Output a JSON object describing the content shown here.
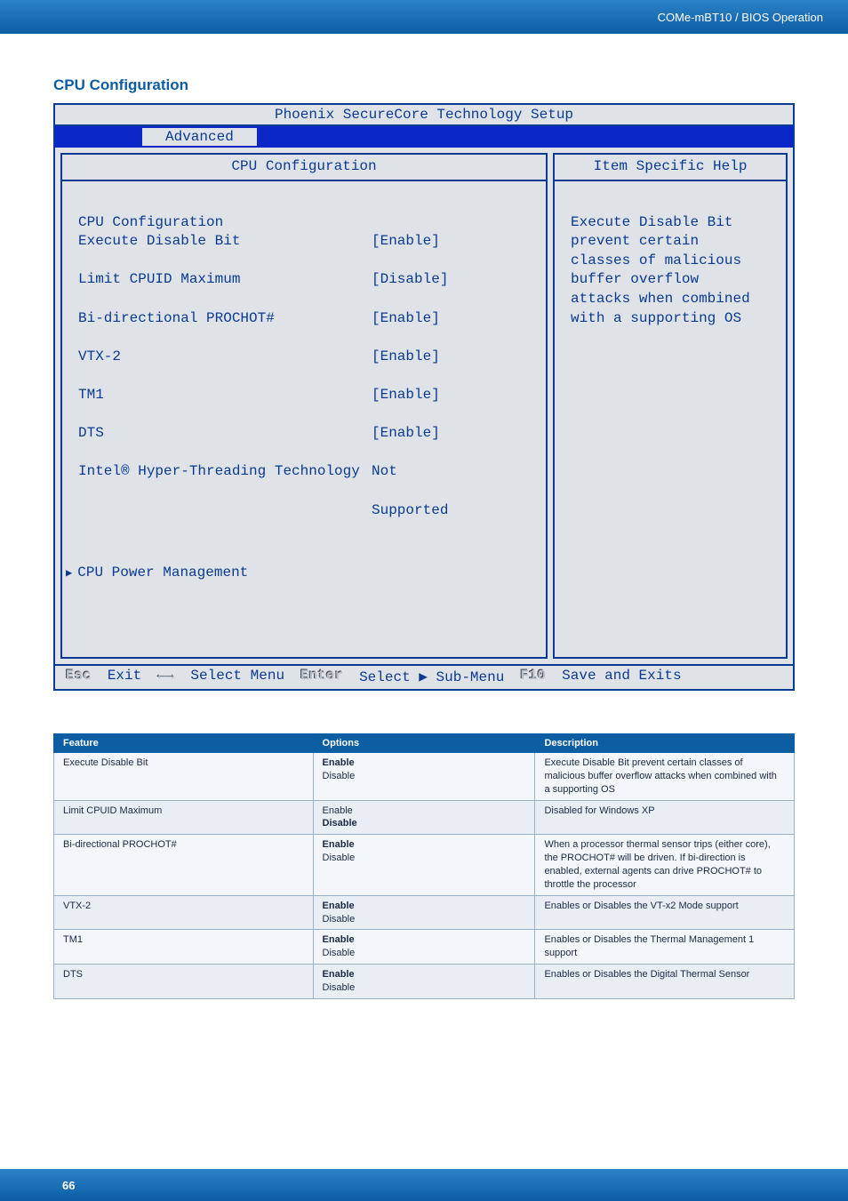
{
  "header": {
    "breadcrumb": "COMe-mBT10 / BIOS Operation"
  },
  "section": {
    "title": "CPU Configuration"
  },
  "bios": {
    "title": "Phoenix SecureCore Technology Setup",
    "tab": "Advanced",
    "left_head": "CPU Configuration",
    "right_head": "Item Specific Help",
    "menu_heading": "CPU Configuration",
    "items": [
      {
        "label": "Execute Disable Bit",
        "value": "[Enable]"
      },
      {
        "label": "Limit CPUID Maximum",
        "value": "[Disable]"
      },
      {
        "label": "Bi-directional PROCHOT#",
        "value": "[Enable]"
      },
      {
        "label": "VTX-2",
        "value": "[Enable]"
      },
      {
        "label": "TM1",
        "value": "[Enable]"
      },
      {
        "label": "DTS",
        "value": "[Enable]"
      },
      {
        "label": "Intel® Hyper-Threading Technology",
        "value": "Not"
      }
    ],
    "extra_value_line": "Supported",
    "submenu": "CPU Power Management",
    "help_lines": [
      "Execute Disable Bit",
      "prevent certain",
      "classes of malicious",
      "buffer overflow",
      "attacks when combined",
      "with a supporting OS"
    ],
    "footer": {
      "esc_key": "Esc",
      "exit": "Exit",
      "arrows_key": "←→",
      "select_menu": "Select Menu",
      "enter_key": "Enter",
      "select_sub": "Select ▶ Sub-Menu",
      "f10_key": "F10",
      "save": "Save and Exits"
    }
  },
  "table": {
    "headers": {
      "feature": "Feature",
      "options": "Options",
      "description": "Description"
    },
    "rows": [
      {
        "feature": "Execute Disable Bit",
        "opt_strong": "Enable",
        "opt_rest": "Disable",
        "desc": "Execute Disable Bit prevent certain classes of malicious buffer overflow attacks when combined with a supporting OS"
      },
      {
        "feature": "Limit CPUID Maximum",
        "opt_strong": "Disable",
        "opt_rest": "Enable",
        "opt_rest_first": true,
        "desc": "Disabled for Windows XP"
      },
      {
        "feature": "Bi-directional PROCHOT#",
        "opt_strong": "Enable",
        "opt_rest": "Disable",
        "desc": "When a processor thermal sensor trips (either core), the PROCHOT# will be driven. If bi-direction is enabled, external agents can drive PROCHOT# to throttle the processor"
      },
      {
        "feature": "VTX-2",
        "opt_strong": "Enable",
        "opt_rest": "Disable",
        "desc": "Enables or Disables the VT-x2 Mode support"
      },
      {
        "feature": "TM1",
        "opt_strong": "Enable",
        "opt_rest": "Disable",
        "desc": "Enables or Disables the Thermal Management 1 support"
      },
      {
        "feature": "DTS",
        "opt_strong": "Enable",
        "opt_rest": "Disable",
        "desc": "Enables or Disables the Digital Thermal Sensor"
      }
    ]
  },
  "footer": {
    "page": "66"
  }
}
